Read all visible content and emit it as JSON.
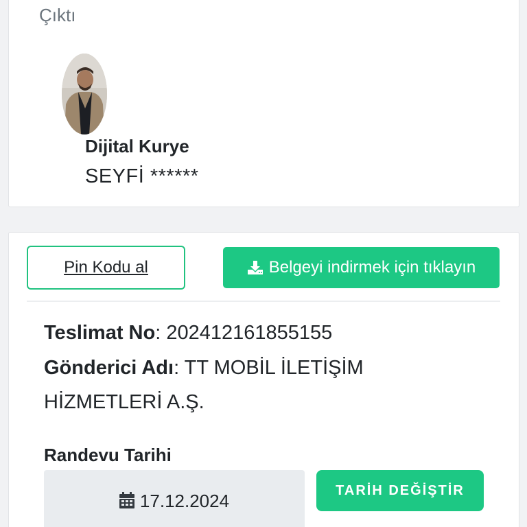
{
  "top_card": {
    "section_title": "Çıktı",
    "courier_title": "Dijital Kurye",
    "courier_name": "SEYFİ ******"
  },
  "actions": {
    "pin_label": "Pin Kodu al",
    "download_label": "Belgeyi indirmek için tıklayın"
  },
  "delivery": {
    "teslimat_label": "Teslimat No",
    "teslimat_value": "202412161855155",
    "gonderici_label": "Gönderici Adı",
    "gonderici_value_line1": "TT MOBİL İLETİŞİM",
    "gonderici_value_line2": "HİZMETLERİ A.Ş."
  },
  "appointment": {
    "label": "Randevu Tarihi",
    "date": "17.12.2024",
    "change_label": "TARİH DEĞİŞTİR"
  },
  "colors": {
    "accent": "#1dc884",
    "muted_text": "#6c757d"
  },
  "icons": {
    "download": "download-icon",
    "calendar": "calendar-icon"
  }
}
